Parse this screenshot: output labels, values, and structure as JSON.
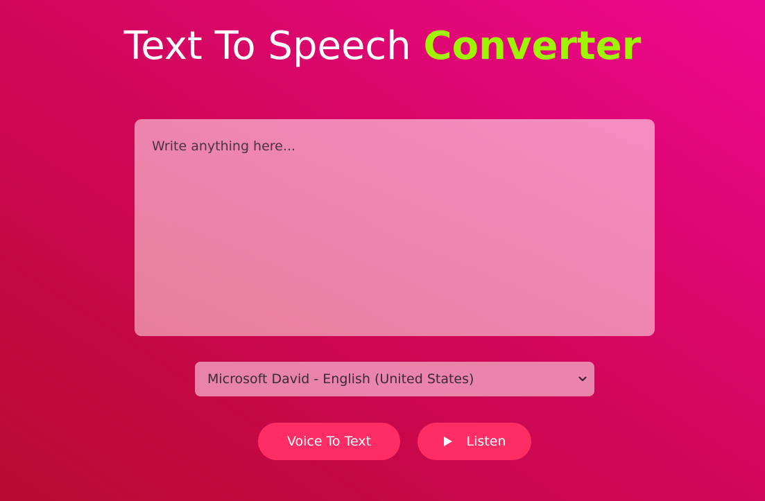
{
  "header": {
    "title_main": "Text To Speech ",
    "title_accent": "Converter"
  },
  "editor": {
    "placeholder": "Write anything here...",
    "value": ""
  },
  "voice_select": {
    "selected": "Microsoft David - English (United States)"
  },
  "buttons": {
    "voice_to_text": "Voice To Text",
    "listen": "Listen"
  },
  "icons": {
    "listen": "play-icon",
    "select": "chevron-down-icon"
  },
  "colors": {
    "accent_text": "#9ff500",
    "button_bg": "#ff2d64",
    "title_text": "#ffffff"
  }
}
